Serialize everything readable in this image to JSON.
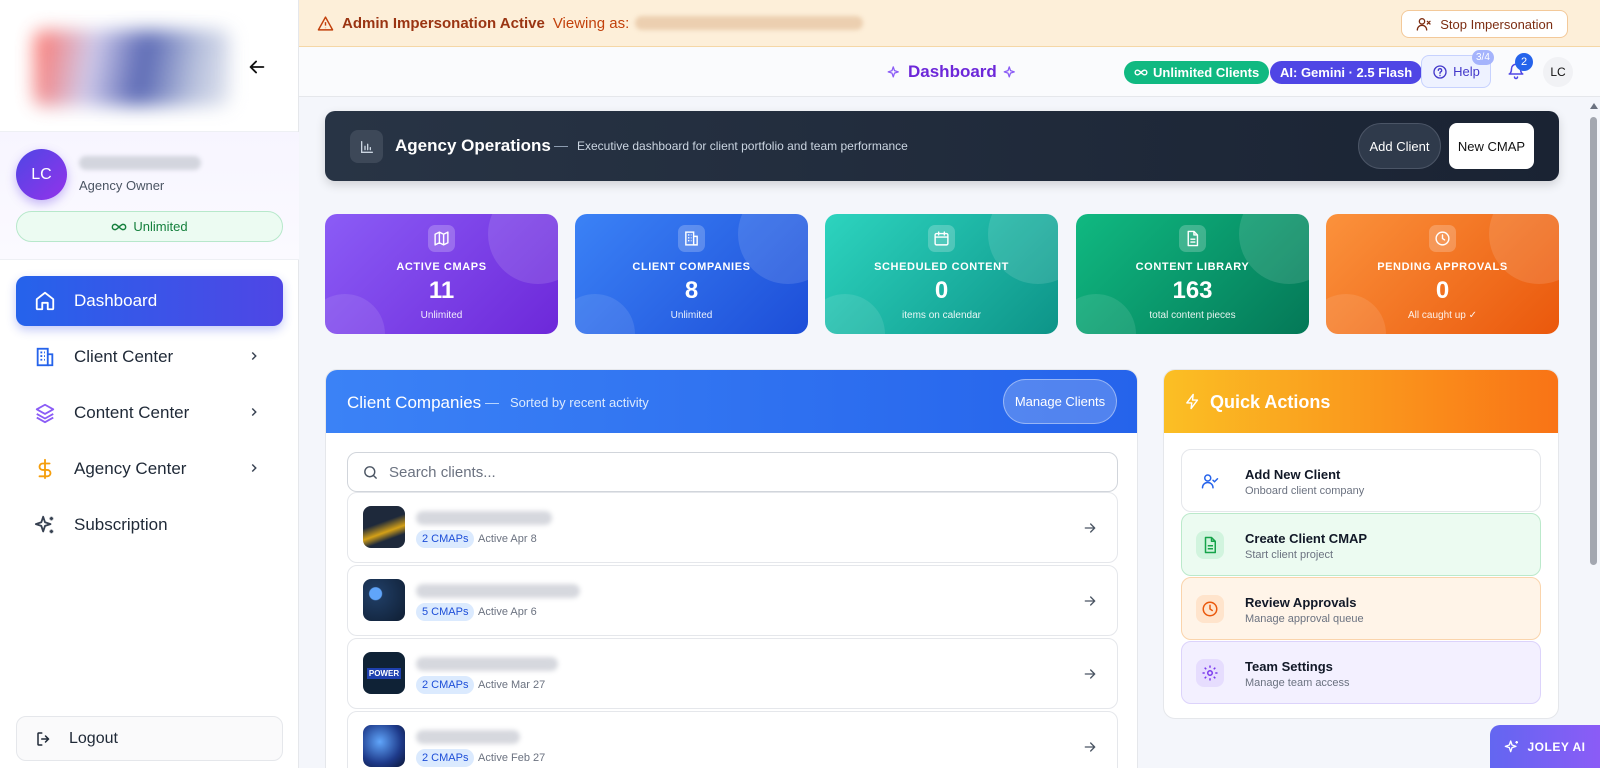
{
  "sidebar": {
    "user": {
      "initials": "LC",
      "role": "Agency Owner",
      "plan": "Unlimited"
    },
    "nav": [
      {
        "label": "Dashboard",
        "icon": "home-icon"
      },
      {
        "label": "Client Center",
        "icon": "building-icon"
      },
      {
        "label": "Content Center",
        "icon": "layers-icon"
      },
      {
        "label": "Agency Center",
        "icon": "dollar-icon"
      },
      {
        "label": "Subscription",
        "icon": "sparkles-icon"
      }
    ],
    "logout": "Logout"
  },
  "banner": {
    "title": "Admin Impersonation Active",
    "viewing": "Viewing as:",
    "stop_button": "Stop Impersonation"
  },
  "header": {
    "title": "Dashboard",
    "pill_clients": "Unlimited Clients",
    "pill_ai": "AI: Gemini · 2.5 Flash",
    "help": "Help",
    "help_badge": "3/4",
    "notifications": "2",
    "avatar": "LC"
  },
  "ops": {
    "title": "Agency Operations",
    "separator": "—",
    "subtitle": "Executive dashboard for client portfolio and team performance",
    "add_client": "Add Client",
    "new_cmap": "New CMAP"
  },
  "stats": [
    {
      "label": "ACTIVE CMAPS",
      "value": "11",
      "sub": "Unlimited",
      "icon": "map-icon"
    },
    {
      "label": "CLIENT COMPANIES",
      "value": "8",
      "sub": "Unlimited",
      "icon": "building-icon"
    },
    {
      "label": "SCHEDULED CONTENT",
      "value": "0",
      "sub": "items on calendar",
      "icon": "calendar-icon"
    },
    {
      "label": "CONTENT LIBRARY",
      "value": "163",
      "sub": "total content pieces",
      "icon": "file-icon"
    },
    {
      "label": "PENDING APPROVALS",
      "value": "0",
      "sub": "All caught up ✓",
      "icon": "clock-icon"
    }
  ],
  "clients": {
    "title": "Client Companies",
    "separator": "—",
    "subtitle": "Sorted by recent activity",
    "manage": "Manage Clients",
    "search_placeholder": "Search clients...",
    "rows": [
      {
        "cmaps": "2 CMAPs",
        "active": "Active Apr 8"
      },
      {
        "cmaps": "5 CMAPs",
        "active": "Active Apr 6"
      },
      {
        "cmaps": "2 CMAPs",
        "active": "Active Mar 27",
        "logo_text": "POWER"
      },
      {
        "cmaps": "2 CMAPs",
        "active": "Active Feb 27"
      }
    ]
  },
  "quick_actions": {
    "title": "Quick Actions",
    "items": [
      {
        "title": "Add New Client",
        "sub": "Onboard client company",
        "icon": "user-check-icon"
      },
      {
        "title": "Create Client CMAP",
        "sub": "Start client project",
        "icon": "file-text-icon"
      },
      {
        "title": "Review Approvals",
        "sub": "Manage approval queue",
        "icon": "clock-icon"
      },
      {
        "title": "Team Settings",
        "sub": "Manage team access",
        "icon": "gear-icon"
      }
    ]
  },
  "assistant": {
    "label": "JOLEY AI"
  },
  "colors": {
    "accent": "#4f46e5",
    "banner_bg": "#fdefd9",
    "stat_purple": "#7c3aed",
    "stat_blue": "#2563eb",
    "stat_teal": "#14b8a6",
    "stat_green": "#059669",
    "stat_orange": "#f97316"
  }
}
